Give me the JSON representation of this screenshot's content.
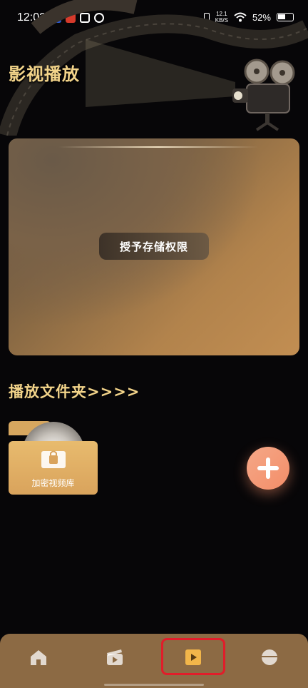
{
  "status_bar": {
    "time": "12:02",
    "net_speed_value": "12.1",
    "net_speed_unit": "KB/S",
    "battery": "52%"
  },
  "header": {
    "title": "影视播放"
  },
  "permission_card": {
    "button_label": "授予存储权限"
  },
  "folders": {
    "section_title": "播放文件夹>>>>",
    "items": [
      {
        "label": "加密视频库"
      }
    ]
  },
  "colors": {
    "accent_gold": "#f3d48a",
    "nav_background": "#8c6a44",
    "add_button": "#f38d68",
    "highlight_box": "#e11d2a"
  },
  "bottom_nav": {
    "items": [
      {
        "icon": "home-icon"
      },
      {
        "icon": "clapperboard-icon"
      },
      {
        "icon": "play-icon",
        "selected": true
      },
      {
        "icon": "profile-icon"
      }
    ]
  }
}
